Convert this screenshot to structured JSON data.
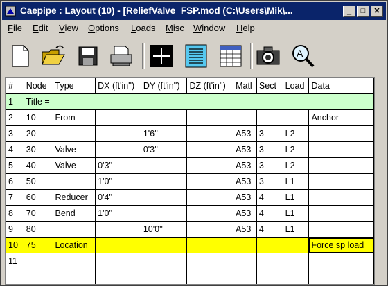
{
  "window": {
    "title": "Caepipe : Layout  (10) - [ReliefValve_FSP.mod (C:\\Users\\Mik\\..."
  },
  "titlebar_buttons": [
    "_",
    "□",
    "✕"
  ],
  "menu": [
    {
      "pre": "",
      "u": "F",
      "post": "ile"
    },
    {
      "pre": "",
      "u": "E",
      "post": "dit"
    },
    {
      "pre": "",
      "u": "V",
      "post": "iew"
    },
    {
      "pre": "",
      "u": "O",
      "post": "ptions"
    },
    {
      "pre": "",
      "u": "L",
      "post": "oads"
    },
    {
      "pre": "",
      "u": "M",
      "post": "isc"
    },
    {
      "pre": "",
      "u": "W",
      "post": "indow"
    },
    {
      "pre": "",
      "u": "H",
      "post": "elp"
    }
  ],
  "toolbar": [
    "new-file-icon",
    "open-folder-icon",
    "save-icon",
    "print-icon",
    "layout-grid-icon",
    "text-list-icon",
    "table-icon",
    "camera-icon",
    "zoom-icon"
  ],
  "columns": [
    "#",
    "Node",
    "Type",
    "DX (ft'in'')",
    "DY (ft'in'')",
    "DZ (ft'in'')",
    "Matl",
    "Sect",
    "Load",
    "Data"
  ],
  "title_row": {
    "num": "1",
    "text": "Title ="
  },
  "rows": [
    {
      "num": "2",
      "node": "10",
      "type": "From",
      "dx": "",
      "dy": "",
      "dz": "",
      "matl": "",
      "sect": "",
      "load": "",
      "data": "Anchor"
    },
    {
      "num": "3",
      "node": "20",
      "type": "",
      "dx": "",
      "dy": "1'6''",
      "dz": "",
      "matl": "A53",
      "sect": "3",
      "load": "L2",
      "data": ""
    },
    {
      "num": "4",
      "node": "30",
      "type": "Valve",
      "dx": "",
      "dy": "0'3''",
      "dz": "",
      "matl": "A53",
      "sect": "3",
      "load": "L2",
      "data": ""
    },
    {
      "num": "5",
      "node": "40",
      "type": "Valve",
      "dx": "0'3''",
      "dy": "",
      "dz": "",
      "matl": "A53",
      "sect": "3",
      "load": "L2",
      "data": ""
    },
    {
      "num": "6",
      "node": "50",
      "type": "",
      "dx": "1'0''",
      "dy": "",
      "dz": "",
      "matl": "A53",
      "sect": "3",
      "load": "L1",
      "data": ""
    },
    {
      "num": "7",
      "node": "60",
      "type": "Reducer",
      "dx": "0'4''",
      "dy": "",
      "dz": "",
      "matl": "A53",
      "sect": "4",
      "load": "L1",
      "data": ""
    },
    {
      "num": "8",
      "node": "70",
      "type": "Bend",
      "dx": "1'0''",
      "dy": "",
      "dz": "",
      "matl": "A53",
      "sect": "4",
      "load": "L1",
      "data": ""
    },
    {
      "num": "9",
      "node": "80",
      "type": "",
      "dx": "",
      "dy": "10'0''",
      "dz": "",
      "matl": "A53",
      "sect": "4",
      "load": "L1",
      "data": ""
    },
    {
      "num": "10",
      "node": "75",
      "type": "Location",
      "dx": "",
      "dy": "",
      "dz": "",
      "matl": "",
      "sect": "",
      "load": "",
      "data": "Force sp load",
      "highlight": true
    },
    {
      "num": "11",
      "node": "",
      "type": "",
      "dx": "",
      "dy": "",
      "dz": "",
      "matl": "",
      "sect": "",
      "load": "",
      "data": ""
    },
    {
      "num": "",
      "node": "",
      "type": "",
      "dx": "",
      "dy": "",
      "dz": "",
      "matl": "",
      "sect": "",
      "load": "",
      "data": ""
    }
  ]
}
